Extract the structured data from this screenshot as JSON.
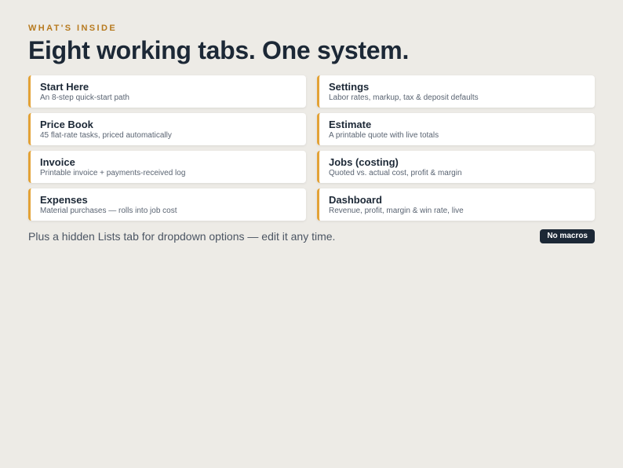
{
  "header": {
    "eyebrow": "WHAT'S INSIDE",
    "title": "Eight working tabs. One system."
  },
  "tabs": [
    {
      "title": "Start Here",
      "description": "An 8-step quick-start path"
    },
    {
      "title": "Settings",
      "description": "Labor rates, markup, tax & deposit defaults"
    },
    {
      "title": "Price Book",
      "description": "45 flat-rate tasks, priced automatically"
    },
    {
      "title": "Estimate",
      "description": "A printable quote with live totals"
    },
    {
      "title": "Invoice",
      "description": "Printable invoice + payments-received log"
    },
    {
      "title": "Jobs (costing)",
      "description": "Quoted vs. actual cost, profit & margin"
    },
    {
      "title": "Expenses",
      "description": "Material purchases — rolls into job cost"
    },
    {
      "title": "Dashboard",
      "description": "Revenue, profit, margin & win rate, live"
    }
  ],
  "footer": {
    "note": "Plus a hidden Lists tab for dropdown options — edit it any time.",
    "badge": "No macros"
  },
  "colors": {
    "background": "#edebe6",
    "accent": "#e3a236",
    "eyebrow": "#b77a1f",
    "heading": "#1c2836",
    "badge_bg": "#1c2836"
  }
}
